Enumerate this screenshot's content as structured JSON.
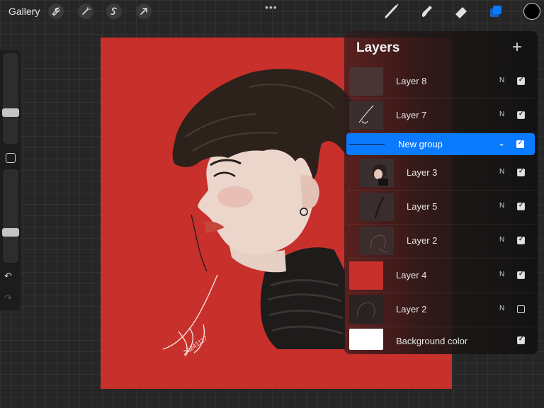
{
  "toolbar": {
    "gallery_label": "Gallery",
    "icons": [
      "wrench-icon",
      "magic-wand-icon",
      "selection-s-icon",
      "transform-arrow-icon"
    ],
    "more_dots": "•••",
    "tools": [
      "brush-icon",
      "smudge-icon",
      "eraser-icon",
      "layers-icon"
    ],
    "active_tool": "layers-icon",
    "current_color": "#000000"
  },
  "sidebar": {
    "brush_size_level": 0.33,
    "opacity_level": 0.6,
    "undo_label": "↶",
    "redo_label": "↷"
  },
  "canvas": {
    "background_color": "#c8302b",
    "signature": "20241117"
  },
  "layers_panel": {
    "title": "Layers",
    "add_label": "+",
    "accent_color": "#0a7aff",
    "layers": [
      {
        "name": "Layer 8",
        "blend": "N",
        "visible": true,
        "nested": false
      },
      {
        "name": "Layer 7",
        "blend": "N",
        "visible": true,
        "nested": false
      },
      {
        "name": "New group",
        "blend": "",
        "visible": true,
        "group": true
      },
      {
        "name": "Layer 3",
        "blend": "N",
        "visible": true,
        "nested": true
      },
      {
        "name": "Layer 5",
        "blend": "N",
        "visible": true,
        "nested": true
      },
      {
        "name": "Layer 2",
        "blend": "N",
        "visible": true,
        "nested": true
      },
      {
        "name": "Layer 4",
        "blend": "N",
        "visible": true,
        "nested": false
      },
      {
        "name": "Layer 2",
        "blend": "N",
        "visible": false,
        "nested": false
      },
      {
        "name": "Background color",
        "blend": "",
        "visible": true,
        "nested": false
      }
    ]
  }
}
